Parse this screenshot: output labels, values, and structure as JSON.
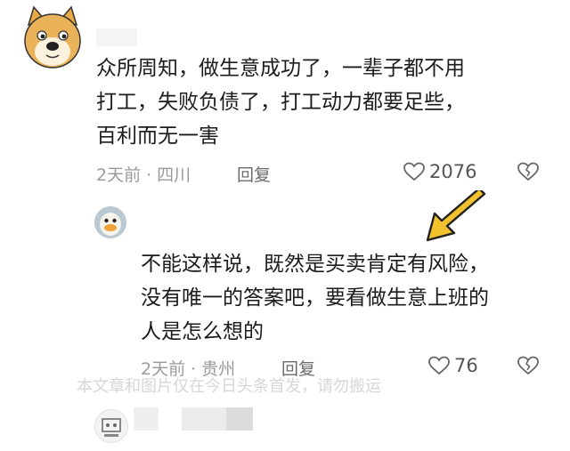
{
  "comments": [
    {
      "text": "众所周知，做生意成功了，一辈子都不用\n打工，失败负债了，打工动力都要足些，\n百利而无一害",
      "time": "2天前",
      "location": "四川",
      "reply_label": "回复",
      "likes": "2076",
      "icons": [
        "heart-outline-icon",
        "broken-heart-icon"
      ]
    },
    {
      "text": "不能这样说，既然是买卖肯定有风险，\n没有唯一的答案吧，要看做生意上班的\n人是怎么想的",
      "time": "2天前",
      "location": "贵州",
      "reply_label": "回复",
      "likes": "76",
      "icons": [
        "heart-outline-icon",
        "broken-heart-icon"
      ]
    }
  ],
  "separator": "·",
  "watermark": "本文章和图片仅在今日头条首发，请勿搬运",
  "colors": {
    "arrow": "#f2c12e",
    "meta_text": "#9a9a9a",
    "body_text": "#1b1b1b"
  }
}
